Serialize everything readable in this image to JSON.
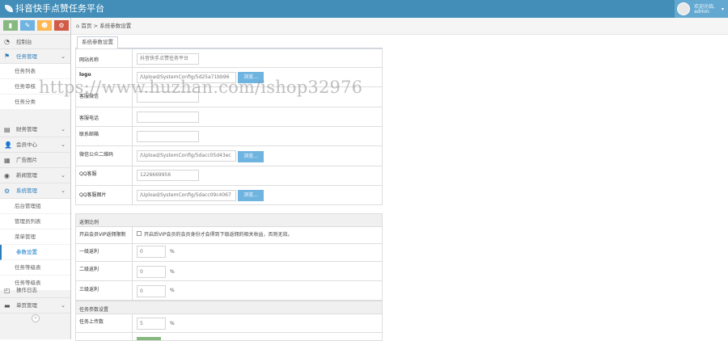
{
  "app": {
    "title": "抖音快手点赞任务平台"
  },
  "user": {
    "greeting": "欢迎光临,",
    "name": "admin",
    "caret": "▾"
  },
  "shortcuts": [
    {
      "icon": "chart-icon",
      "glyph": "▮",
      "color": "#87b87f"
    },
    {
      "icon": "pencil-icon",
      "glyph": "✎",
      "color": "#6fb3e0"
    },
    {
      "icon": "users-icon",
      "glyph": "☻",
      "color": "#ffb752"
    },
    {
      "icon": "cog-icon",
      "glyph": "⚙",
      "color": "#d15b47"
    }
  ],
  "nav": [
    {
      "icon": "dashboard-icon",
      "glyph": "◔",
      "label": "控制台",
      "arrow": ""
    },
    {
      "icon": "flag-icon",
      "glyph": "⚑",
      "label": "任务管理",
      "arrow": "⌄",
      "active": true
    },
    {
      "icon": "finance-icon",
      "glyph": "▤",
      "label": "财务管理",
      "arrow": "⌄"
    },
    {
      "icon": "user-icon",
      "glyph": "👤",
      "label": "会员中心",
      "arrow": "⌄"
    },
    {
      "icon": "picture-icon",
      "glyph": "▦",
      "label": "广告图片",
      "arrow": ""
    },
    {
      "icon": "globe-icon",
      "glyph": "◉",
      "label": "新闻管理",
      "arrow": "⌄"
    },
    {
      "icon": "cogs-icon",
      "glyph": "⚙",
      "label": "系统管理",
      "arrow": "⌄",
      "active": true
    },
    {
      "icon": "bookmark-icon",
      "glyph": "◰",
      "label": "操作日志",
      "arrow": ""
    },
    {
      "icon": "book-icon",
      "glyph": "▬",
      "label": "单页管理",
      "arrow": "⌄"
    }
  ],
  "task_sub": [
    "任务列表",
    "任务审核",
    "任务分类"
  ],
  "system_sub": [
    "后台管理组",
    "管理员列表",
    "菜单管理",
    "参数设置",
    "任务等级表",
    "任务等级表"
  ],
  "collapse": "«",
  "breadcrumb": {
    "home": "首页",
    "sep": ">",
    "current": "系统参数设置"
  },
  "tab": "系统参数设置",
  "form": {
    "site_name": {
      "label": "网站名称",
      "value": "抖音快手点赞任务平台"
    },
    "logo": {
      "label": "logo",
      "value": "/Upload/SystemConfig/5d25a71bb96",
      "button": "浏览..."
    },
    "wechat": {
      "label": "客服微信",
      "value": ""
    },
    "phone": {
      "label": "客服电话",
      "value": ""
    },
    "email": {
      "label": "联系邮箱",
      "value": ""
    },
    "wechat_qr": {
      "label": "微信公众二维码",
      "value": "/Upload/SystemConfig/5dacc05d43ec",
      "button": "浏览..."
    },
    "qq": {
      "label": "QQ客服",
      "value": "1226669956"
    },
    "qq_img": {
      "label": "QQ客服图片",
      "value": "/Upload/SystemConfig/5dacc09c4067",
      "button": "浏览..."
    },
    "section_rebate": "返佣比例",
    "vip_rebate": {
      "label": "开启会员VIP返佣限制",
      "text": "开启后VIP会员的会员身份才会得到下级返佣的相关收益，否则无效。"
    },
    "level1": {
      "label": "一级返利",
      "value": "0",
      "unit": "%"
    },
    "level2": {
      "label": "二级返利",
      "value": "0",
      "unit": "%"
    },
    "level3": {
      "label": "三级返利",
      "value": "0",
      "unit": "%"
    },
    "section_task": "任务参数设置",
    "task_limit": {
      "label": "任务上传数",
      "value": "5",
      "unit": "%"
    }
  },
  "watermark": "https://www.huzhan.com/ishop32976"
}
